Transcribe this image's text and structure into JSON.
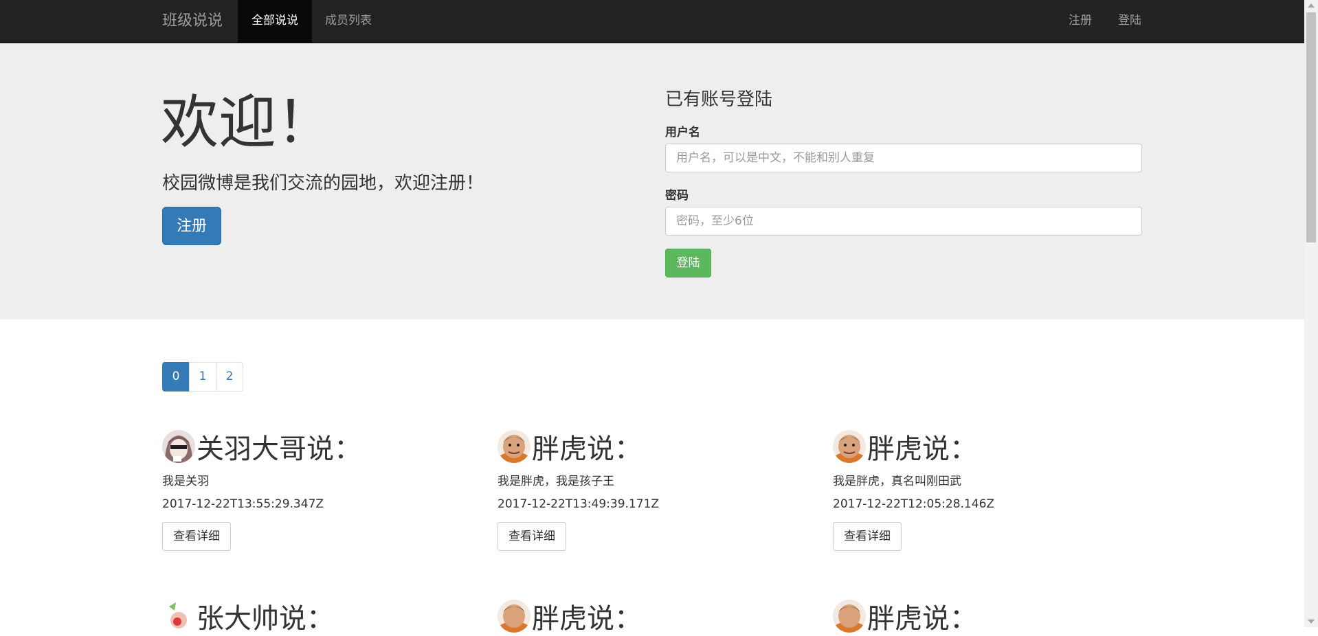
{
  "navbar": {
    "brand": "班级说说",
    "tabs": [
      {
        "label": "全部说说",
        "active": true
      },
      {
        "label": "成员列表",
        "active": false
      }
    ],
    "right": [
      {
        "label": "注册"
      },
      {
        "label": "登陆"
      }
    ]
  },
  "hero": {
    "title": "欢迎！",
    "lead": "校园微博是我们交流的园地，欢迎注册！",
    "register_button": "注册"
  },
  "login": {
    "title": "已有账号登陆",
    "username_label": "用户名",
    "username_placeholder": "用户名，可以是中文，不能和别人重复",
    "password_label": "密码",
    "password_placeholder": "密码，至少6位",
    "submit": "登陆"
  },
  "pagination": {
    "pages": [
      "0",
      "1",
      "2"
    ],
    "active": "0"
  },
  "posts": [
    {
      "author": "关羽大哥说：",
      "content": "我是关羽",
      "time": "2017-12-22T13:55:29.347Z",
      "detail": "查看详细",
      "avatar": "anime-avatar"
    },
    {
      "author": "胖虎说：",
      "content": "我是胖虎，我是孩子王",
      "time": "2017-12-22T13:49:39.171Z",
      "detail": "查看详细",
      "avatar": "gian-avatar"
    },
    {
      "author": "胖虎说：",
      "content": "我是胖虎，真名叫刚田武",
      "time": "2017-12-22T12:05:28.146Z",
      "detail": "查看详细",
      "avatar": "gian-avatar"
    },
    {
      "author": "张大帅说：",
      "avatar": "cartoon-avatar"
    },
    {
      "author": "胖虎说：",
      "avatar": "gian-avatar"
    },
    {
      "author": "胖虎说：",
      "avatar": "gian-avatar"
    }
  ],
  "colors": {
    "navbar_bg": "#222222",
    "jumbotron_bg": "#eeeeee",
    "primary": "#337ab7",
    "success": "#5cb85c"
  }
}
